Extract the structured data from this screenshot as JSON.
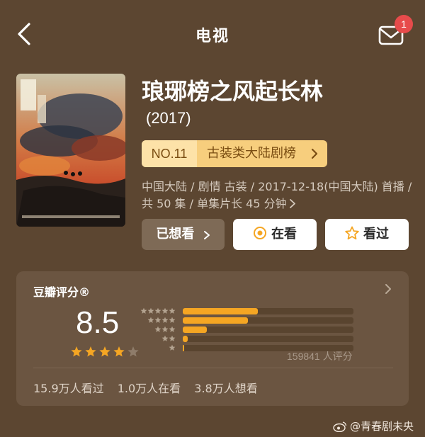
{
  "header": {
    "title": "电视",
    "notification_count": "1"
  },
  "show": {
    "title": "琅琊榜之风起长林",
    "year": "(2017)",
    "rank_no": "NO.11",
    "rank_label": "古装类大陆剧榜",
    "meta": "中国大陆 / 剧情 古装 / 2017-12-18(中国大陆) 首播 / 共 50 集 / 单集片长 45 分钟"
  },
  "actions": {
    "wanted": "已想看",
    "watching": "在看",
    "watched": "看过"
  },
  "rating": {
    "title": "豆瓣评分®",
    "score": "8.5",
    "score_stars": 4.25,
    "distribution": [
      0.44,
      0.38,
      0.14,
      0.03,
      0.01
    ],
    "count": "159841 人评分",
    "stats": [
      "15.9万人看过",
      "1.0万人在看",
      "3.8万人想看"
    ]
  },
  "watermark": "@青春剧未央",
  "colors": {
    "background": "#5c4631",
    "card": "#6b5541",
    "accent": "#f5a623",
    "rank_pill": "#f7ce7d"
  }
}
